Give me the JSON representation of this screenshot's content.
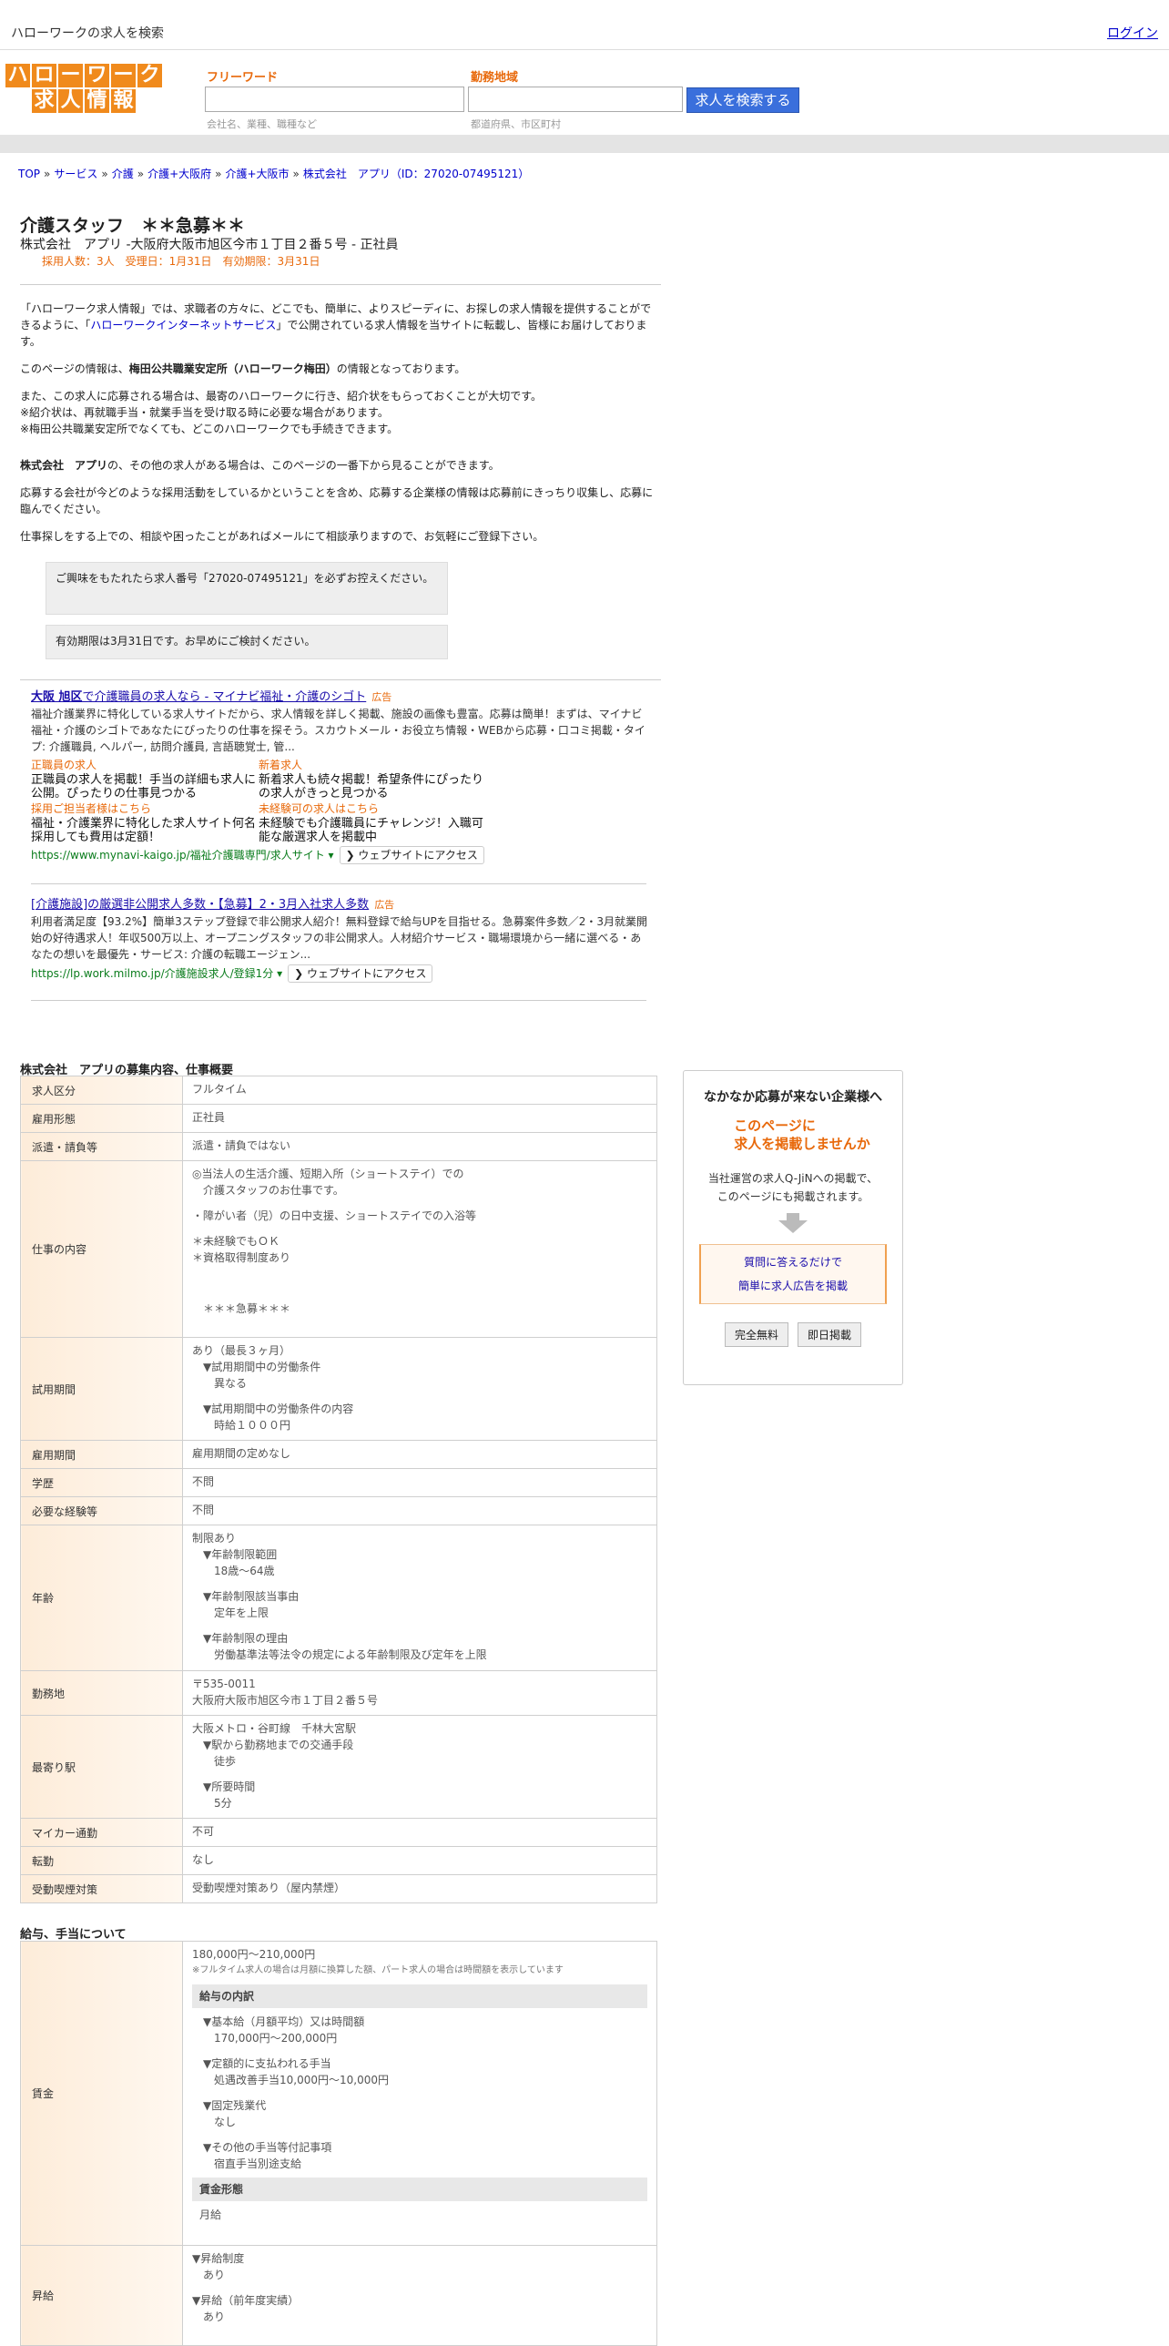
{
  "topbar": {
    "site_title": "ハローワークの求人を検索",
    "login": "ログイン"
  },
  "logo": {
    "top_chars": [
      "ハ",
      "ロ",
      "ー",
      "ワ",
      "ー",
      "ク"
    ],
    "bottom_chars": [
      "求",
      "人",
      "情",
      "報"
    ]
  },
  "search": {
    "freeword_label": "フリーワード",
    "freeword_hint": "会社名、業種、職種など",
    "area_label": "勤務地域",
    "area_hint": "都道府県、市区町村",
    "button": "求人を検索する"
  },
  "breadcrumb": [
    "TOP",
    "サービス",
    "介護",
    "介護+大阪府",
    "介護+大阪市",
    "株式会社　アプリ（ID：27020-07495121）"
  ],
  "breadcrumb_sep": "»",
  "job": {
    "title": "介護スタッフ　＊＊急募＊＊",
    "company_line": "株式会社　アプリ -大阪府大阪市旭区今市１丁目２番５号 - 正社員",
    "meta": "採用人数：3人　受理日：1月31日　有効期限：3月31日"
  },
  "intro": {
    "p1_a": "「ハローワーク求人情報」では、求職者の方々に、どこでも、簡単に、よりスピーディに、お探しの求人情報を提供することができるように、「",
    "p1_link": "ハローワークインターネットサービス",
    "p1_b": "」で公開されている求人情報を当サイトに転載し、皆様にお届けしております。",
    "p2_a": "このページの情報は、",
    "p2_bold": "梅田公共職業安定所（ハローワーク梅田）",
    "p2_b": "の情報となっております。",
    "p3_l1": "また、この求人に応募される場合は、最寄のハローワークに行き、紹介状をもらっておくことが大切です。",
    "p3_l2": "※紹介状は、再就職手当・就業手当を受け取る時に必要な場合があります。",
    "p3_l3": "※梅田公共職業安定所でなくても、どこのハローワークでも手続きできます。",
    "p4_bold": "株式会社　アプリ",
    "p4_rest": "の、その他の求人がある場合は、このページの一番下から見ることができます。",
    "p5": "応募する会社が今どのような採用活動をしているかということを含め、応募する企業様の情報は応募前にきっちり収集し、応募に臨んでください。",
    "p6": "仕事探しをする上での、相談や困ったことがあればメールにて相談承りますので、お気軽にご登録下さい。"
  },
  "notes": {
    "note1": "ご興味をもたれたら求人番号「27020-07495121」を必ずお控えください。",
    "note2": "有効期限は3月31日です。お早めにご検討ください。"
  },
  "ads": [
    {
      "title_bold": "大阪 旭区",
      "title_rest": "で介護職員の求人なら - マイナビ福祉・介護のシゴト",
      "badge": "広告",
      "desc": "福祉介護業界に特化している求人サイトだから、求人情報を詳しく掲載、施設の画像も豊富。応募は簡単！まずは、マイナビ福祉・介護のシゴトであなたにぴったりの仕事を探そう。スカウトメール・お役立ち情報・WEBから応募・口コミ掲載・タイプ: 介護職員, ヘルパー, 訪問介護員, 言語聴覚士, 管...",
      "sitelinks": [
        {
          "title": "正職員の求人",
          "desc": "正職員の求人を掲載！手当の詳細も求人に公開。ぴったりの仕事見つかる"
        },
        {
          "title": "新着求人",
          "desc": "新着求人も続々掲載！希望条件にぴったりの求人がきっと見つかる"
        },
        {
          "title": "採用ご担当者様はこちら",
          "desc": "福祉・介護業界に特化した求人サイト何名採用しても費用は定額！"
        },
        {
          "title": "未経験可の求人はこちら",
          "desc": "未経験でも介護職員にチャレンジ！入職可能な厳選求人を掲載中"
        }
      ],
      "url": "https://www.mynavi-kaigo.jp/福祉介護職専門/求人サイト ▾",
      "button": "❯ ウェブサイトにアクセス"
    },
    {
      "title_bold": "",
      "title_rest": "[介護施設]の厳選非公開求人多数・【急募】2・3月入社求人多数",
      "badge": "広告",
      "desc": "利用者満足度【93.2%】簡単3ステップ登録で非公開求人紹介！無料登録で給与UPを目指せる。急募案件多数／2・3月就業開始の好待遇求人！年収500万以上、オープニングスタッフの非公開求人。人材紹介サービス・職場環境から一緒に選べる・あなたの想いを最優先・サービス: 介護の転職エージェン...",
      "sitelinks": [],
      "url": "https://lp.work.milmo.jp/介護施設求人/登録1分 ▾",
      "button": "❯ ウェブサイトにアクセス"
    }
  ],
  "details": {
    "section_title": "株式会社　アプリの募集内容、仕事概要",
    "rows": {
      "category": {
        "label": "求人区分",
        "value": "フルタイム"
      },
      "employment": {
        "label": "雇用形態",
        "value": "正社員"
      },
      "dispatch": {
        "label": "派遣・請負等",
        "value": "派遣・請負ではない"
      },
      "work": {
        "label": "仕事の内容",
        "l1": "◎当法人の生活介護、短期入所（ショートステイ）での",
        "l2": "介護スタッフのお仕事です。",
        "l3": "・障がい者（児）の日中支援、ショートステイでの入浴等",
        "l4": "＊未経験でもＯＫ",
        "l5": "＊資格取得制度あり",
        "l6": "＊＊＊急募＊＊＊"
      },
      "trial": {
        "label": "試用期間",
        "l1": "あり（最長３ヶ月）",
        "l2": "▼試用期間中の労働条件",
        "l3": "異なる",
        "l4": "▼試用期間中の労働条件の内容",
        "l5": "時給１０００円"
      },
      "period": {
        "label": "雇用期間",
        "value": "雇用期間の定めなし"
      },
      "education": {
        "label": "学歴",
        "value": "不問"
      },
      "experience": {
        "label": "必要な経験等",
        "value": "不問"
      },
      "age": {
        "label": "年齢",
        "l1": "制限あり",
        "l2": "▼年齢制限範囲",
        "l3": "18歳〜64歳",
        "l4": "▼年齢制限該当事由",
        "l5": "定年を上限",
        "l6": "▼年齢制限の理由",
        "l7": "労働基準法等法令の規定による年齢制限及び定年を上限"
      },
      "location": {
        "label": "勤務地",
        "l1": "〒535-0011",
        "l2": "大阪府大阪市旭区今市１丁目２番５号"
      },
      "station": {
        "label": "最寄り駅",
        "l1": "大阪メトロ・谷町線　千林大宮駅",
        "l2": "▼駅から勤務地までの交通手段",
        "l3": "徒歩",
        "l4": "▼所要時間",
        "l5": "5分"
      },
      "car": {
        "label": "マイカー通勤",
        "value": "不可"
      },
      "transfer": {
        "label": "転勤",
        "value": "なし"
      },
      "smoking": {
        "label": "受動喫煙対策",
        "value": "受動喫煙対策あり（屋内禁煙）"
      }
    }
  },
  "salary": {
    "section_title": "給与、手当について",
    "wage": {
      "label": "賃金",
      "range": "180,000円〜210,000円",
      "note": "※フルタイム求人の場合は月額に換算した額、パート求人の場合は時間額を表示しています",
      "breakdown_head": "給与の内訳",
      "b1": "▼基本給（月額平均）又は時間額",
      "b2": "170,000円〜200,000円",
      "b3": "▼定額的に支払われる手当",
      "b4": "処遇改善手当10,000円〜10,000円",
      "b5": "▼固定残業代",
      "b6": "なし",
      "b7": "▼その他の手当等付記事項",
      "b8": "宿直手当別途支給",
      "form_head": "賃金形態",
      "form": "月給"
    },
    "raise": {
      "label": "昇給",
      "l1": "▼昇給制度",
      "l2": "あり",
      "l3": "▼昇給（前年度実績）",
      "l4": "あり"
    }
  },
  "sidebar": {
    "title": "なかなか応募が来ない企業様へ",
    "catch1": "このページに",
    "catch2": "求人を掲載しませんか",
    "text1": "当社運営の求人Q-JiNへの掲載で、",
    "text2": "このページにも掲載されます。",
    "link1": "質問に答えるだけで",
    "link2": "簡単に求人広告を掲載",
    "btn1": "完全無料",
    "btn2": "即日掲載"
  }
}
